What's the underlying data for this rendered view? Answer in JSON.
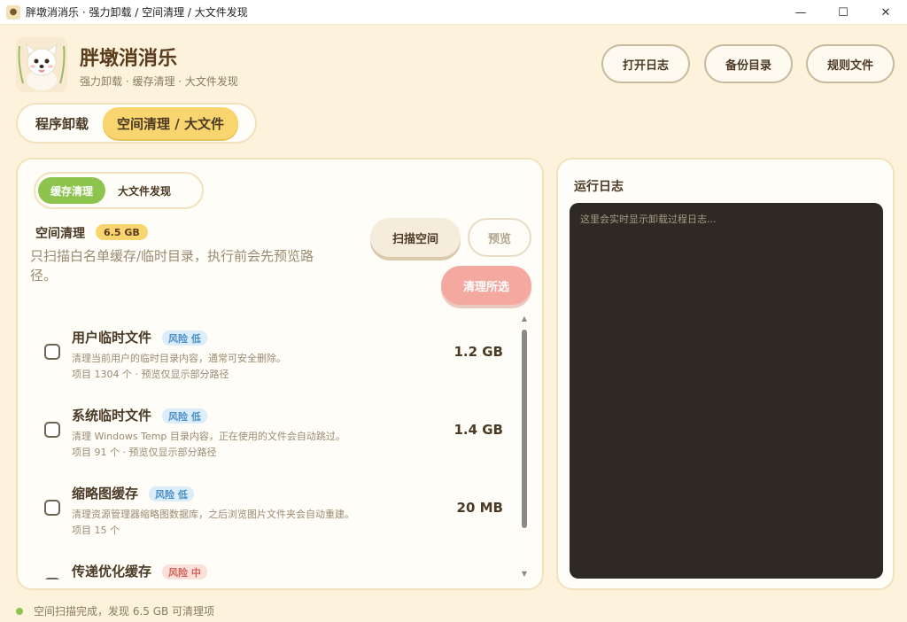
{
  "window": {
    "title": "胖墩消消乐 · 强力卸载 / 空间清理 / 大文件发现",
    "minimize_glyph": "—",
    "maximize_glyph": "☐",
    "close_glyph": "✕"
  },
  "header": {
    "app_name": "胖墩消消乐",
    "subtitle": "强力卸载 · 缓存清理 · 大文件发现",
    "buttons": {
      "open_log": "打开日志",
      "backup_dir": "备份目录",
      "rule_file": "规则文件"
    }
  },
  "main_tabs": [
    {
      "label": "程序卸载",
      "active": false
    },
    {
      "label": "空间清理 / 大文件",
      "active": true
    }
  ],
  "sub_tabs": [
    {
      "label": "缓存清理",
      "active": true
    },
    {
      "label": "大文件发现",
      "active": false
    }
  ],
  "cleanup": {
    "title": "空间清理",
    "total_size": "6.5 GB",
    "description": "只扫描白名单缓存/临时目录，执行前会先预览路径。",
    "scan_label": "扫描空间",
    "preview_label": "预览",
    "clean_label": "清理所选",
    "items": [
      {
        "name": "用户临时文件",
        "risk": "风险 低",
        "risk_level": "low",
        "desc": "清理当前用户的临时目录内容，通常可安全删除。",
        "meta": "项目 1304 个 · 预览仅显示部分路径",
        "size": "1.2 GB",
        "checked": false
      },
      {
        "name": "系统临时文件",
        "risk": "风险 低",
        "risk_level": "low",
        "desc": "清理 Windows Temp 目录内容，正在使用的文件会自动跳过。",
        "meta": "项目 91 个 · 预览仅显示部分路径",
        "size": "1.4 GB",
        "checked": false
      },
      {
        "name": "缩略图缓存",
        "risk": "风险 低",
        "risk_level": "low",
        "desc": "清理资源管理器缩略图数据库，之后浏览图片文件夹会自动重建。",
        "meta": "项目 15 个",
        "size": "20 MB",
        "checked": false
      },
      {
        "name": "传递优化缓存",
        "risk": "风险 中",
        "risk_level": "mid",
        "desc": "",
        "meta": "",
        "size": "",
        "checked": false
      }
    ]
  },
  "log": {
    "title": "运行日志",
    "placeholder": "这里会实时显示卸载过程日志..."
  },
  "status": {
    "text": "空间扫描完成，发现 6.5 GB 可清理项"
  },
  "colors": {
    "background": "#fdf3dc",
    "accent_yellow": "#f8d56f",
    "accent_green": "#8cc44e",
    "clean_pink": "#f3a8a0",
    "log_bg": "#2e2922"
  }
}
